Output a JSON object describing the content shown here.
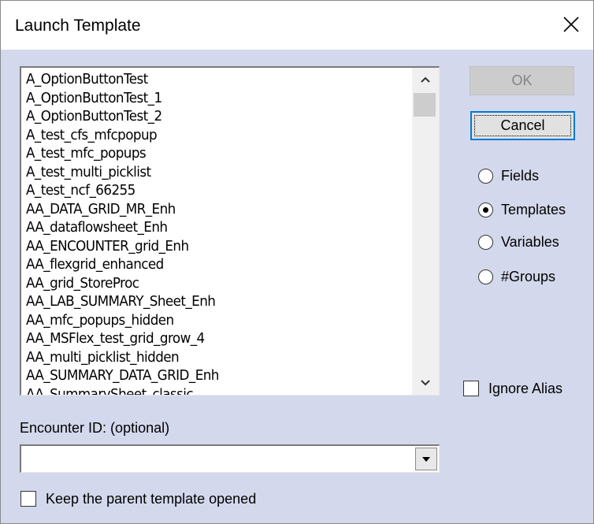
{
  "window": {
    "title": "Launch Template",
    "close_icon": "close-icon"
  },
  "template_list": {
    "items": [
      "A_OptionButtonTest",
      "A_OptionButtonTest_1",
      "A_OptionButtonTest_2",
      "A_test_cfs_mfcpopup",
      "A_test_mfc_popups",
      "A_test_multi_picklist",
      "A_test_ncf_66255",
      "AA_DATA_GRID_MR_Enh",
      "AA_dataflowsheet_Enh",
      "AA_ENCOUNTER_grid_Enh",
      "AA_flexgrid_enhanced",
      "AA_grid_StoreProc",
      "AA_LAB_SUMMARY_Sheet_Enh",
      "AA_mfc_popups_hidden",
      "AA_MSFlex_test_grid_grow_4",
      "AA_multi_picklist_hidden",
      "AA_SUMMARY_DATA_GRID_Enh",
      "AA_SummarySheet_classic"
    ],
    "scroll_up_icon": "chevron-up-icon",
    "scroll_down_icon": "chevron-down-icon"
  },
  "buttons": {
    "ok_label": "OK",
    "cancel_label": "Cancel"
  },
  "view_options": {
    "selected": "Templates",
    "options": [
      "Fields",
      "Templates",
      "Variables",
      "#Groups"
    ]
  },
  "ignore_alias": {
    "label": "Ignore Alias",
    "checked": false
  },
  "encounter": {
    "label": "Encounter ID:  (optional)",
    "value": ""
  },
  "keep_parent": {
    "label": "Keep the parent template opened",
    "checked": false
  }
}
